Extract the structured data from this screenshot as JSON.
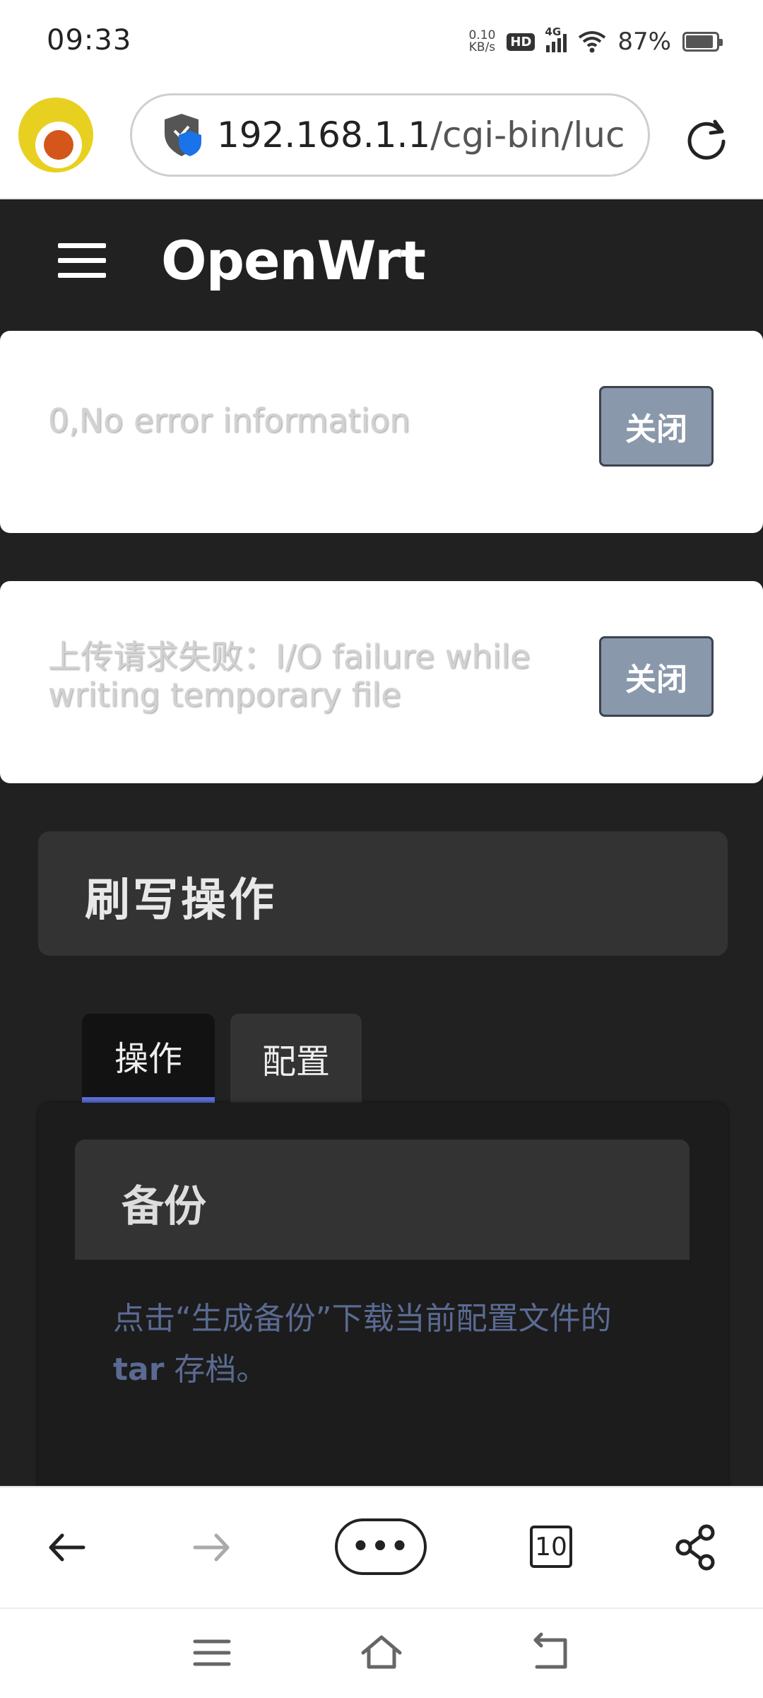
{
  "status_bar": {
    "time": "09:33",
    "net_speed_value": "0.10",
    "net_speed_unit": "KB/s",
    "hd_label": "HD",
    "network_label": "4G",
    "battery_percent": "87%"
  },
  "browser": {
    "url_host": "192.168.1.1",
    "url_path": "/cgi-bin/luc",
    "tab_count": "10"
  },
  "header": {
    "brand": "OpenWrt"
  },
  "alerts": [
    {
      "message": "0,No error information",
      "close_label": "关闭"
    },
    {
      "message": "上传请求失败：I/O failure while writing temporary file",
      "close_label": "关闭"
    }
  ],
  "section": {
    "title": "刷写操作",
    "tabs": [
      {
        "label": "操作",
        "active": true
      },
      {
        "label": "配置",
        "active": false
      }
    ],
    "backup": {
      "title": "备份",
      "desc_part1": "点击“生成备份”下载当前配置文件的",
      "desc_bold": "tar",
      "desc_part2": " 存档。"
    }
  },
  "colors": {
    "page_bg": "#212121",
    "tab_accent": "#5a6fd6",
    "close_button": "#8a98ab",
    "desc_text": "#5a6a92"
  }
}
